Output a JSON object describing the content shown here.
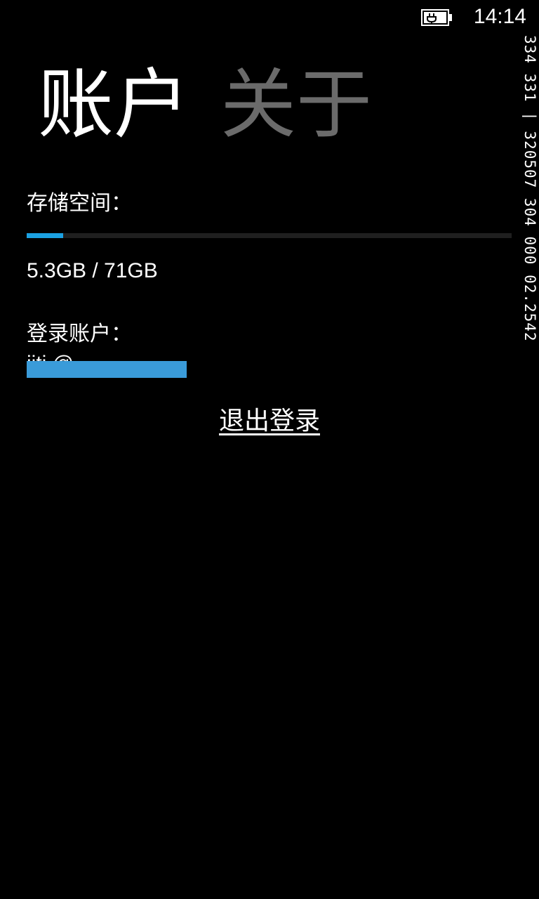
{
  "status_bar": {
    "time": "14:14",
    "battery_icon": "battery-charging-icon"
  },
  "pivot": {
    "items": [
      {
        "label": "账户",
        "active": true
      },
      {
        "label": "关于",
        "active": false
      }
    ]
  },
  "storage": {
    "label": "存储空间：",
    "used": "5.3GB",
    "total": "71GB",
    "value_text": "5.3GB / 71GB",
    "used_fraction": 0.075,
    "accent_color": "#1ba1e2"
  },
  "account": {
    "label": "登录账户：",
    "email_visible": "jiti  @",
    "redaction_color": "#3a9bd9"
  },
  "logout": {
    "label": "退出登录"
  },
  "debug_overlay": {
    "text": "334 331 | 320507 304 000 02.2542"
  }
}
